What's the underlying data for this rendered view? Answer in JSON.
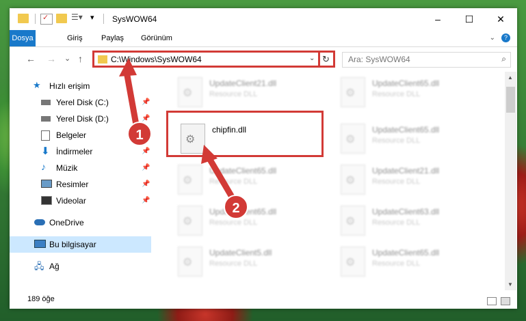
{
  "window": {
    "title": "SysWOW64",
    "controls": {
      "minimize": "–",
      "maximize": "☐",
      "close": "✕"
    }
  },
  "ribbon": {
    "tabs": [
      "Dosya",
      "Giriş",
      "Paylaş",
      "Görünüm"
    ],
    "help": "?"
  },
  "nav": {
    "back": "←",
    "forward": "→",
    "recent": "⌄",
    "up": "↑",
    "address": "C:\\Windows\\SysWOW64",
    "search_placeholder": "Ara: SysWOW64"
  },
  "sidebar": {
    "items": [
      {
        "label": "Hızlı erişim",
        "icon": "star-icon"
      },
      {
        "label": "Yerel Disk (C:)",
        "icon": "drive-icon"
      },
      {
        "label": "Yerel Disk (D:)",
        "icon": "drive-icon"
      },
      {
        "label": "Belgeler",
        "icon": "documents-icon"
      },
      {
        "label": "İndirmeler",
        "icon": "download-icon"
      },
      {
        "label": "Müzik",
        "icon": "music-icon"
      },
      {
        "label": "Resimler",
        "icon": "pictures-icon"
      },
      {
        "label": "Videolar",
        "icon": "video-icon"
      },
      {
        "label": "OneDrive",
        "icon": "cloud-icon"
      },
      {
        "label": "Bu bilgisayar",
        "icon": "computer-icon"
      },
      {
        "label": "Ağ",
        "icon": "network-icon"
      }
    ]
  },
  "files": [
    {
      "name": "UpdateClient21.dll",
      "type": "Resource DLL"
    },
    {
      "name": "UpdateClient65.dll",
      "type": "Resource DLL"
    },
    {
      "name": "chipfin.dll",
      "type": ""
    },
    {
      "name": "UpdateClient65.dll",
      "type": "Resource DLL"
    },
    {
      "name": "UpdateClient65.dll",
      "type": "Resource DLL"
    },
    {
      "name": "UpdateClient21.dll",
      "type": "Resource DLL"
    },
    {
      "name": "UpdateClient65.dll",
      "type": "Resource DLL"
    },
    {
      "name": "UpdateClient63.dll",
      "type": "Resource DLL"
    },
    {
      "name": "UpdateClient5.dll",
      "type": "Resource DLL"
    },
    {
      "name": "UpdateClient65.dll",
      "type": "Resource DLL"
    }
  ],
  "status": {
    "count": "189 öğe"
  },
  "callouts": [
    "1",
    "2"
  ],
  "colors": {
    "accent": "#1979ca",
    "highlight": "#d23a36",
    "selection": "#cce8ff"
  }
}
